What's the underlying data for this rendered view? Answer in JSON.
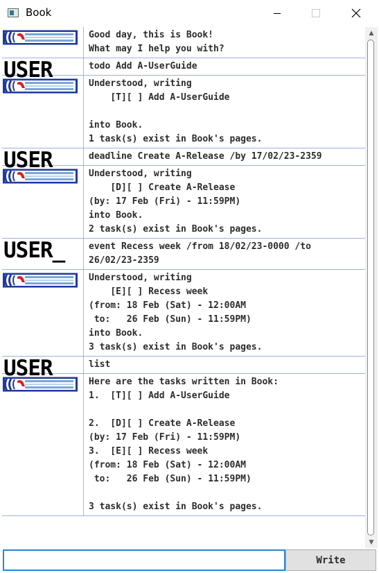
{
  "window": {
    "title": "Book",
    "icon": "app-window-icon",
    "controls": [
      "minimize-icon",
      "maximize-icon",
      "close-icon"
    ]
  },
  "avatars": {
    "user_label": "USER_",
    "bot_icon": "book-bot-icon"
  },
  "messages": [
    {
      "sender": "bot",
      "text": "Good day, this is Book!\nWhat may I help you with?"
    },
    {
      "sender": "user",
      "text": "todo Add A-UserGuide"
    },
    {
      "sender": "bot",
      "text": "Understood, writing\n    [T][ ] Add A-UserGuide\n\ninto Book.\n1 task(s) exist in Book's pages."
    },
    {
      "sender": "user",
      "text": "deadline Create A-Release /by 17/02/23-2359"
    },
    {
      "sender": "bot",
      "text": "Understood, writing\n    [D][ ] Create A-Release\n(by: 17 Feb (Fri) - 11:59PM)\ninto Book.\n2 task(s) exist in Book's pages."
    },
    {
      "sender": "user",
      "text": "event Recess week /from 18/02/23-0000 /to\n26/02/23-2359"
    },
    {
      "sender": "bot",
      "text": "Understood, writing\n    [E][ ] Recess week\n(from: 18 Feb (Sat) - 12:00AM\n to:   26 Feb (Sun) - 11:59PM)\ninto Book.\n3 task(s) exist in Book's pages."
    },
    {
      "sender": "user",
      "text": "list"
    },
    {
      "sender": "bot",
      "text": "Here are the tasks written in Book:\n1.  [T][ ] Add A-UserGuide\n\n2.  [D][ ] Create A-Release\n(by: 17 Feb (Fri) - 11:59PM)\n3.  [E][ ] Recess week\n(from: 18 Feb (Sat) - 12:00AM\n to:   26 Feb (Sun) - 11:59PM)\n\n3 task(s) exist in Book's pages."
    }
  ],
  "input": {
    "value": "",
    "placeholder": ""
  },
  "send_button": {
    "label": "Write"
  },
  "colors": {
    "row_divider": "#9bb3d8",
    "avatar_divider": "#e6a0a0",
    "input_focus": "#2a84d8",
    "bot_icon_blue": "#1e3a9e",
    "bot_icon_red": "#d42020"
  }
}
